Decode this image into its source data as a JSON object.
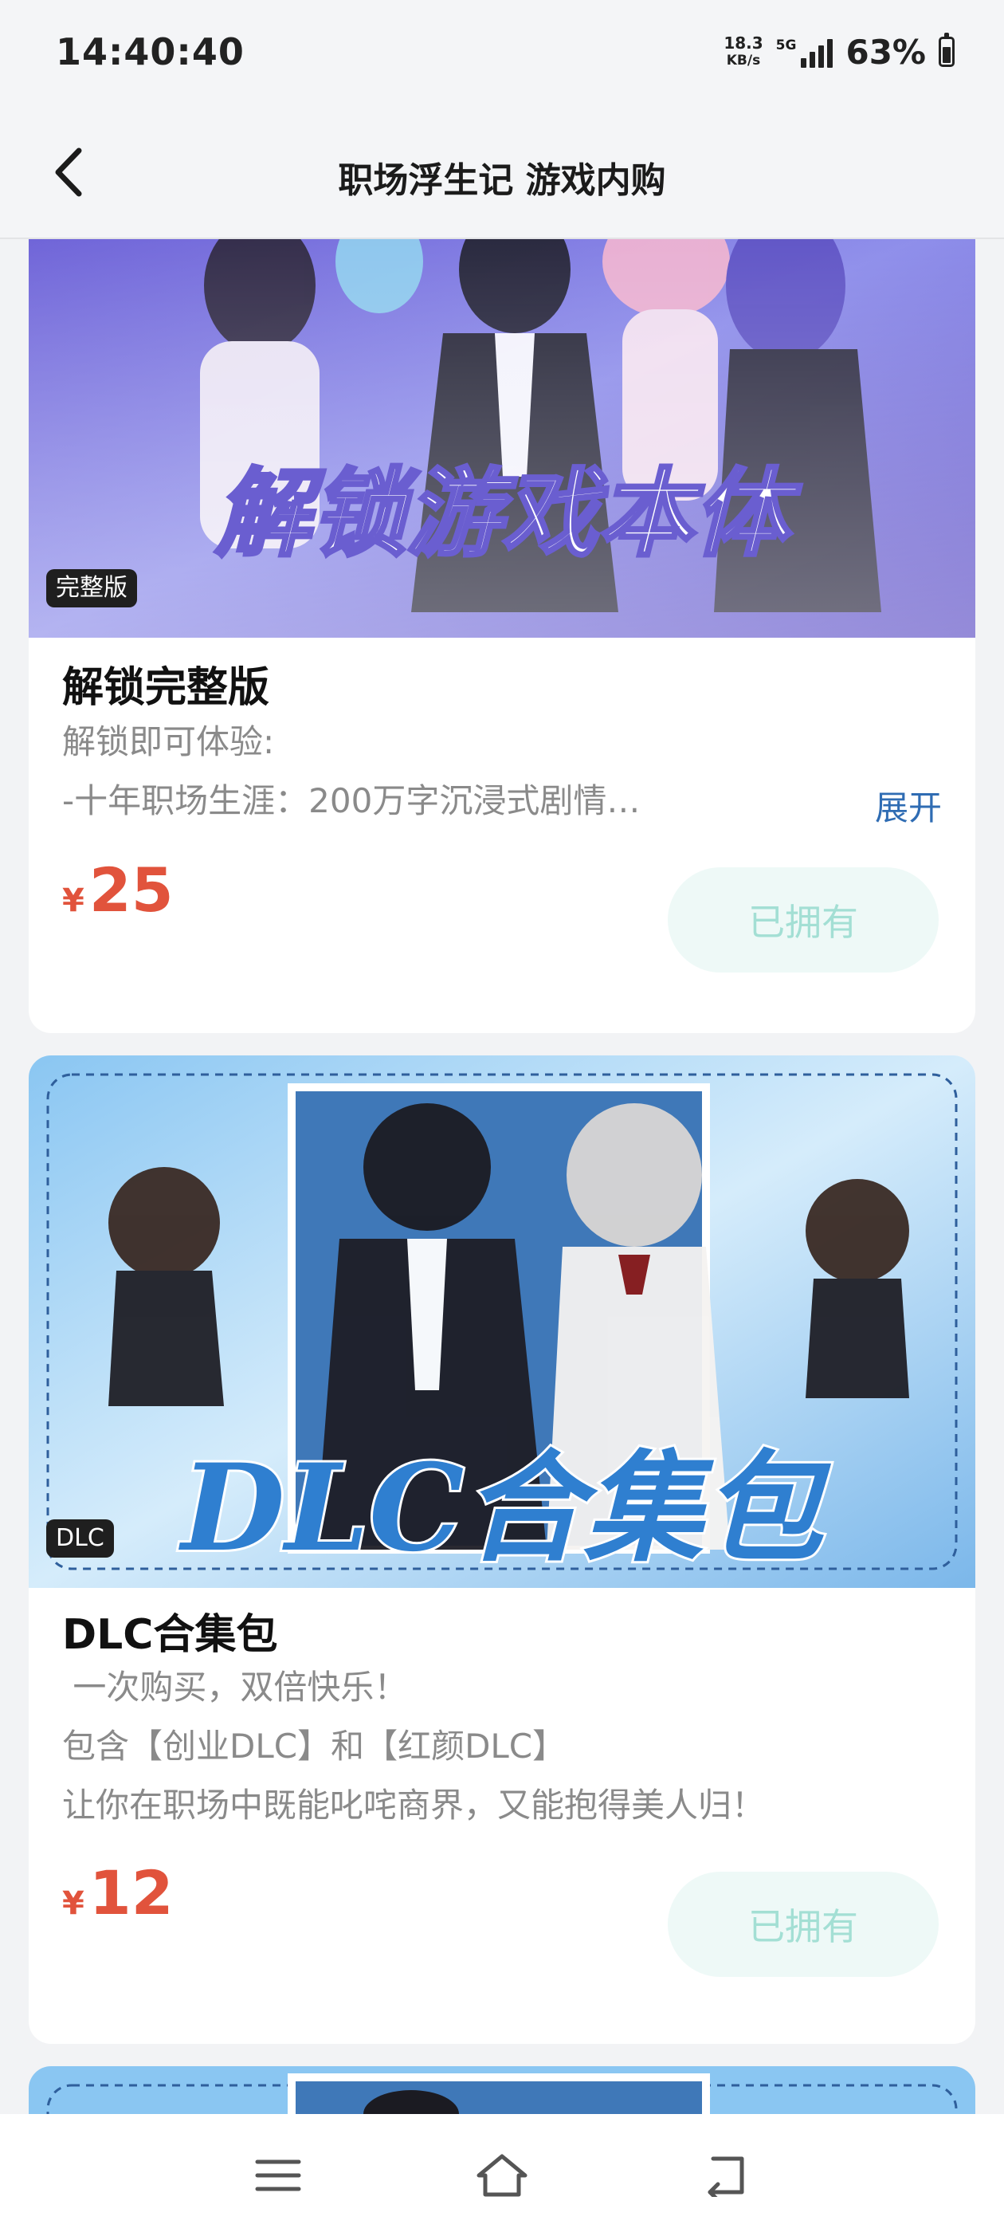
{
  "status": {
    "time": "14:40:40",
    "net_speed_value": "18.3",
    "net_speed_unit": "KB/s",
    "signal_label": "5G",
    "battery": "63%",
    "battery_level": 0.63
  },
  "header": {
    "title": "职场浮生记 游戏内购",
    "back_icon": "chevron-left-icon"
  },
  "items": [
    {
      "banner_text": "解锁游戏本体",
      "tag": "完整版",
      "title": "解锁完整版",
      "desc_line1": "解锁即可体验:",
      "desc_line2": "-十年职场生涯：200万字沉浸式剧情…",
      "expand_label": "展开",
      "currency": "¥",
      "price": "25",
      "button_label": "已拥有"
    },
    {
      "banner_text": "DLC合集包",
      "tag": "DLC",
      "title": "DLC合集包",
      "desc_line1": " 一次购买，双倍快乐！",
      "desc_line2": "包含【创业DLC】和【红颜DLC】",
      "desc_line3": "让你在职场中既能叱咤商界，又能抱得美人归！",
      "currency": "¥",
      "price": "12",
      "button_label": "已拥有"
    }
  ],
  "navbar": {
    "menu_icon": "menu-icon",
    "home_icon": "home-icon",
    "back_icon": "back-arrow-icon"
  },
  "colors": {
    "price": "#e1533c",
    "expand_link": "#2f6cb3",
    "owned_button_bg": "#eef9f7",
    "owned_button_text": "#a3dfd4"
  }
}
